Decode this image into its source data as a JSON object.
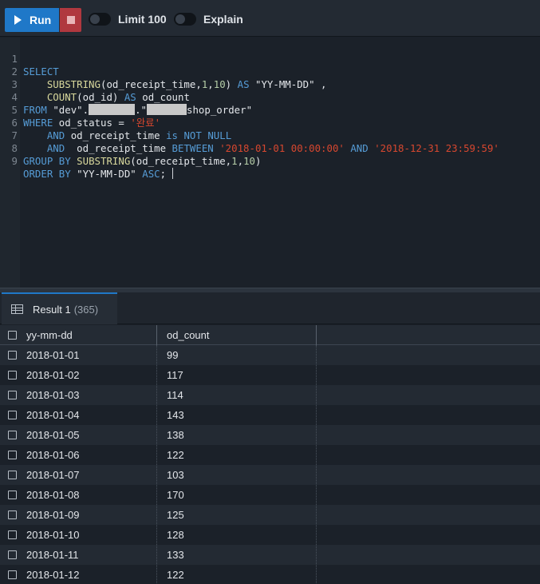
{
  "toolbar": {
    "run_label": "Run",
    "limit_label": "Limit 100",
    "explain_label": "Explain"
  },
  "editor": {
    "line_numbers": [
      "1",
      "2",
      "3",
      "4",
      "5",
      "6",
      "7",
      "8",
      "9"
    ],
    "line1": {
      "kw": "SELECT"
    },
    "line2": {
      "fn": "SUBSTRING",
      "arg": "(od_receipt_time,",
      "n1": "1",
      "c": ",",
      "n2": "10",
      "p": ")",
      "as": "AS",
      "alias": "\"YY-MM-DD\" ,"
    },
    "line3": {
      "fn": "COUNT",
      "arg": "(od_id)",
      "as": "AS",
      "alias": "od_count"
    },
    "line4": {
      "kw": "FROM",
      "db": "\"dev\".",
      "sep": ".\"",
      "tbl": "shop_order\""
    },
    "line5": {
      "kw": "WHERE",
      "col": "od_status",
      "op": "=",
      "val": "'완료'"
    },
    "line6": {
      "kw": "AND",
      "col": "od_receipt_time",
      "is": "is",
      "not": "NOT",
      "null": "NULL"
    },
    "line7": {
      "kw": "AND",
      "col": "od_receipt_time",
      "between": "BETWEEN",
      "from": "'2018-01-01 00:00:00'",
      "and": "AND",
      "to": "'2018-12-31 23:59:59'"
    },
    "line8": {
      "kw": "GROUP BY",
      "fn": "SUBSTRING",
      "arg": "(od_receipt_time,",
      "n1": "1",
      "c": ",",
      "n2": "10",
      "p": ")"
    },
    "line9": {
      "kw": "ORDER BY",
      "alias": "\"YY-MM-DD\"",
      "asc": "ASC",
      "end": ";"
    }
  },
  "results": {
    "tab_label": "Result 1",
    "tab_count": "(365)",
    "columns": [
      "yy-mm-dd",
      "od_count"
    ],
    "rows": [
      [
        "2018-01-01",
        "99"
      ],
      [
        "2018-01-02",
        "117"
      ],
      [
        "2018-01-03",
        "114"
      ],
      [
        "2018-01-04",
        "143"
      ],
      [
        "2018-01-05",
        "138"
      ],
      [
        "2018-01-06",
        "122"
      ],
      [
        "2018-01-07",
        "103"
      ],
      [
        "2018-01-08",
        "170"
      ],
      [
        "2018-01-09",
        "125"
      ],
      [
        "2018-01-10",
        "128"
      ],
      [
        "2018-01-11",
        "133"
      ],
      [
        "2018-01-12",
        "122"
      ]
    ]
  },
  "colors": {
    "accent": "#1f78c8",
    "stop": "#b0383f",
    "string": "#d7472f",
    "keyword": "#569cd6"
  },
  "icons": [
    "play-icon",
    "stop-icon",
    "table-icon",
    "checkbox-icon"
  ]
}
